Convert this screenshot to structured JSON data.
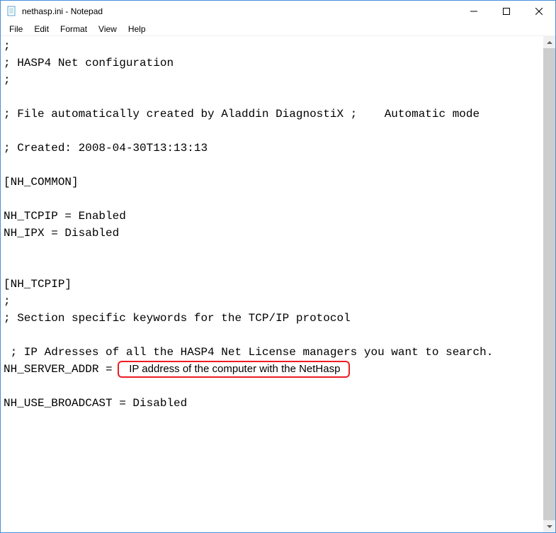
{
  "window": {
    "title": "nethasp.ini - Notepad"
  },
  "menubar": {
    "items": [
      "File",
      "Edit",
      "Format",
      "View",
      "Help"
    ]
  },
  "editor": {
    "lines": [
      ";",
      "; HASP4 Net configuration",
      ";",
      "",
      "; File automatically created by Aladdin DiagnostiX ;    Automatic mode",
      "",
      "; Created: 2008-04-30T13:13:13",
      "",
      "[NH_COMMON]",
      "",
      "NH_TCPIP = Enabled",
      "NH_IPX = Disabled",
      "",
      "",
      "[NH_TCPIP]",
      ";",
      "; Section specific keywords for the TCP/IP protocol",
      "",
      " ; IP Adresses of all the HASP4 Net License managers you want to search."
    ],
    "server_addr_line_prefix": "NH_SERVER_ADDR = ",
    "highlight_text": "IP address of the computer with the NetHasp",
    "lines_after": [
      "",
      "NH_USE_BROADCAST = Disabled"
    ]
  }
}
